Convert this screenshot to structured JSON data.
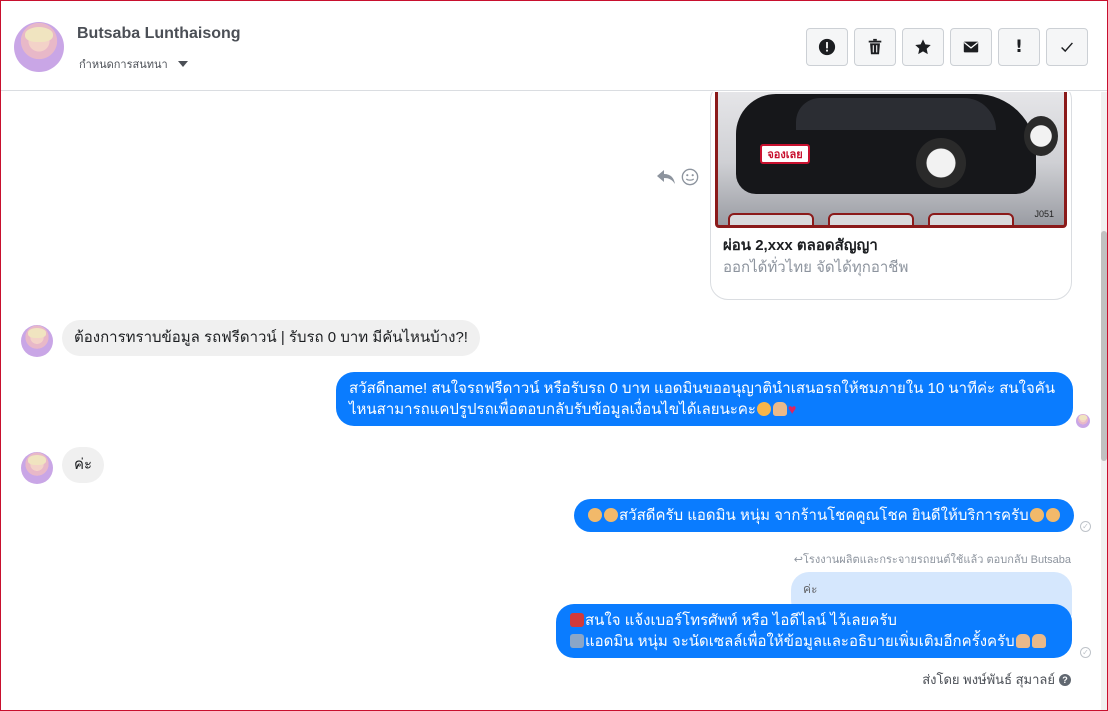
{
  "header": {
    "contact_name": "Butsaba Lunthaisong",
    "assign_label": "กำหนดการสนทนา"
  },
  "toolbar": [
    {
      "icon": "spam-icon",
      "label": ""
    },
    {
      "icon": "trash-icon",
      "label": ""
    },
    {
      "icon": "star-icon",
      "label": ""
    },
    {
      "icon": "mail-icon",
      "label": ""
    },
    {
      "icon": "exclamation-icon",
      "label": "!"
    },
    {
      "icon": "check-icon",
      "label": ""
    }
  ],
  "card": {
    "plate_text": "จองเลย",
    "image_code": "J051",
    "title": "ผ่อน 2,xxx ตลอดสัญญา",
    "subtitle": "ออกได้ทั่วไทย จัดได้ทุกอาชีพ"
  },
  "messages": {
    "in_1": "ต้องการทราบข้อมูล รถฟรีดาวน์ | รับรถ 0 บาท มีคันไหนบ้าง?!",
    "out_1_line1": "สวัสดีname! สนใจรถฟรีดาวน์ หรือรับรถ 0 บาท แอดมินขออนุญาตินำเสนอรถให้ชมภายใน 10 นาทีค่ะ สนใจคัน",
    "out_1_line2": "ไหนสามารถแคปรูปรถเพื่อตอบกลับรับข้อมูลเงื่อนไขได้เลยนะคะ",
    "in_2": "ค่ะ",
    "out_2": "สวัสดีครับ แอดมิน หนุ่ม จากร้านโชคคูณโชค ยินดีให้บริการครับ",
    "reply_label": "โรงงานผลิตและกระจายรถยนต์ใช้แล้ว ตอบกลับ Butsaba",
    "quoted": "ค่ะ",
    "out_3_line1": "สนใจ แจ้งเบอร์โทรศัพท์ หรือ ไอดีไลน์  ไว้เลยครับ",
    "out_3_line2": "แอดมิน หนุ่ม จะนัดเซลล์เพื่อให้ข้อมูลและอธิบายเพิ่มเติมอีกครั้งครับ",
    "sent_by": "ส่งโดย พงษ์พันธ์ สุมาลย์"
  }
}
